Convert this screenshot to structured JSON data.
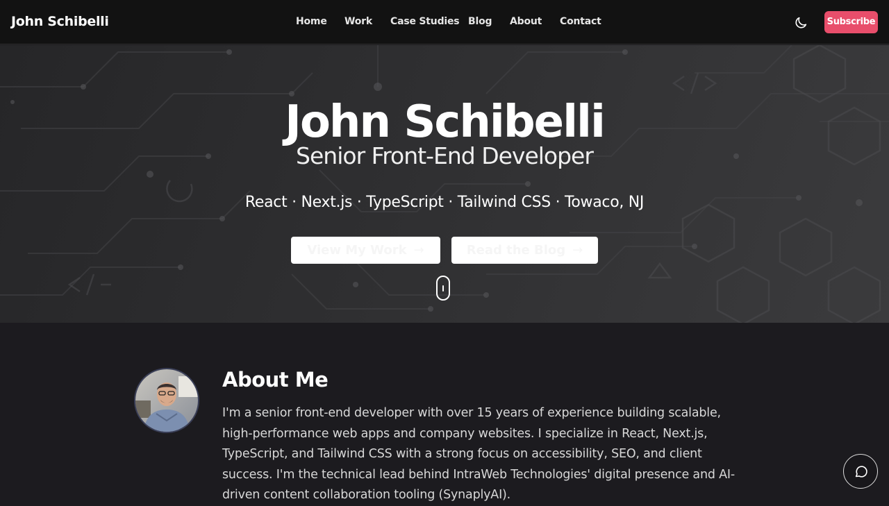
{
  "nav": {
    "brand": "John Schibelli",
    "links": [
      "Home",
      "Work",
      "Case Studies",
      "Blog",
      "About",
      "Contact"
    ],
    "theme_icon": "moon-icon",
    "subscribe_label": "Subscribe"
  },
  "hero": {
    "title": "John Schibelli",
    "subtitle": "Senior Front-End Developer",
    "tags": "React · Next.js · TypeScript · Tailwind CSS · Towaco, NJ",
    "primary_button": "View My Work",
    "secondary_button": "Read the Blog",
    "button_icon": "arrow-right-icon",
    "scroll_icon": "mouse-scroll-icon"
  },
  "about": {
    "title": "About Me",
    "text": "I'm a senior front-end developer with over 15 years of experience building scalable, high-performance web apps and company websites. I specialize in React, Next.js, TypeScript, and Tailwind CSS with a strong focus on accessibility, SEO, and client success. I'm the technical lead behind IntraWeb Technologies' digital presence and AI-driven content collaboration tooling (SynaplyAI).",
    "avatar_icon": "avatar-photo"
  },
  "chat": {
    "icon": "chat-bubble-icon"
  },
  "colors": {
    "accent": "#e84e6b",
    "nav_bg": "#121212",
    "page_bg": "#1c1b1f"
  }
}
